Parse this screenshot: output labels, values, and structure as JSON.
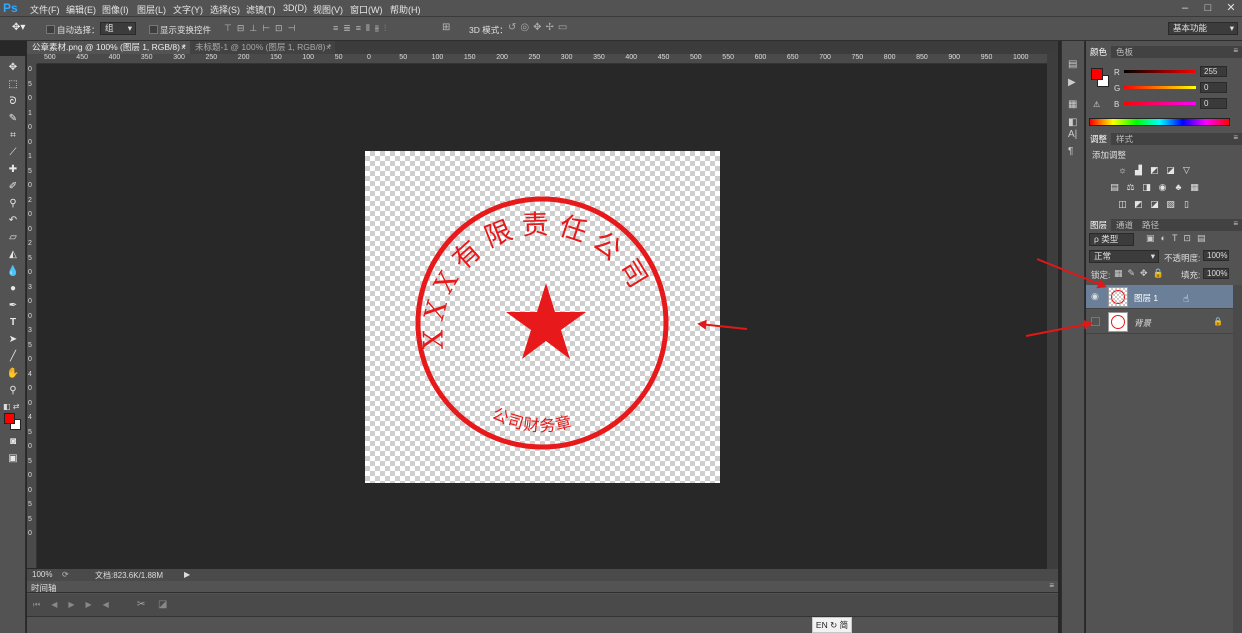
{
  "app": {
    "logo": "Ps",
    "menu": [
      "文件(F)",
      "编辑(E)",
      "图像(I)",
      "图层(L)",
      "文字(Y)",
      "选择(S)",
      "滤镜(T)",
      "3D(D)",
      "视图(V)",
      "窗口(W)",
      "帮助(H)"
    ],
    "window_controls": [
      "–",
      "□",
      "✕"
    ]
  },
  "options": {
    "auto_select_label": "自动选择：",
    "auto_select_value": "组",
    "show_transform_label": "显示变换控件",
    "mode_3d_label": "3D 模式：",
    "workspace": "基本功能"
  },
  "tabs": [
    {
      "label": "公章素材.png @ 100% (图层 1, RGB/8) *",
      "close": "×",
      "active": true
    },
    {
      "label": "未标题-1 @ 100% (图层 1, RGB/8) *",
      "close": "×",
      "active": false
    }
  ],
  "ruler": {
    "h_labels": [
      "500",
      "450",
      "400",
      "350",
      "300",
      "250",
      "200",
      "150",
      "100",
      "50",
      "0",
      "50",
      "100",
      "150",
      "200",
      "250",
      "300",
      "350",
      "400",
      "450",
      "500",
      "550",
      "600",
      "650",
      "700",
      "750",
      "800",
      "850",
      "900",
      "950",
      "1000"
    ],
    "v_labels": [
      "0",
      "5",
      "0",
      "1",
      "0",
      "0",
      "1",
      "5",
      "0",
      "2",
      "0",
      "0",
      "2",
      "5",
      "0",
      "3",
      "0",
      "0",
      "3",
      "5",
      "0",
      "4",
      "0",
      "0",
      "4",
      "5",
      "0",
      "5",
      "0",
      "0",
      "5",
      "5",
      "0"
    ]
  },
  "stamp": {
    "top_text": "XXX有限责任公司",
    "bottom_text": "公司财务章",
    "color": "#e8191a"
  },
  "status": {
    "zoom": "100%",
    "doc": "文档:823.6K/1.88M"
  },
  "timeline": {
    "title": "时间轴"
  },
  "color_panel": {
    "tabs": [
      "颜色",
      "色板"
    ],
    "r_label": "R",
    "r_value": "255",
    "g_label": "G",
    "g_value": "0",
    "b_label": "B",
    "b_value": "0",
    "foreground": "#ff0000"
  },
  "adjust_panel": {
    "tabs": [
      "调整",
      "样式"
    ],
    "title": "添加调整"
  },
  "layers_panel": {
    "tabs": [
      "图层",
      "通道",
      "路径"
    ],
    "filter": "ρ 类型",
    "blend_mode": "正常",
    "opacity_label": "不透明度:",
    "opacity": "100%",
    "lock_label": "锁定:",
    "fill_label": "填充:",
    "fill": "100%",
    "layers": [
      {
        "name": "图层 1",
        "selected": true,
        "visible": true
      },
      {
        "name": "背景",
        "selected": false,
        "visible": false,
        "locked": true
      }
    ]
  },
  "ime": "EN ↻ 简"
}
